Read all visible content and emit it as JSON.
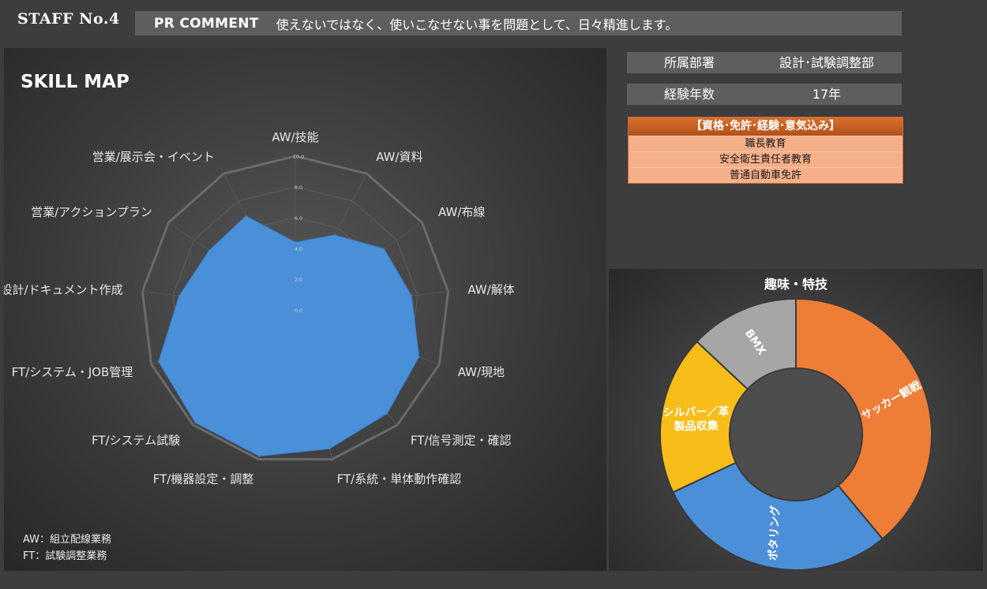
{
  "header": {
    "staff_label": "STAFF No.4",
    "pr_label": "PR COMMENT",
    "pr_text": "使えないではなく、使いこなせない事を問題として、日々精進します。"
  },
  "info": {
    "department_label": "所属部署",
    "department_value": "設計･試験調整部",
    "experience_label": "経験年数",
    "experience_value": "17年"
  },
  "qualifications": {
    "title": "【資格･免許･経験･意気込み】",
    "items": [
      "職長教育",
      "安全衛生責任者教育",
      "普通自動車免許"
    ]
  },
  "notes": {
    "aw": "AW：組立配線業務",
    "ft": "FT：試験調整業務"
  },
  "colors": {
    "radar_fill": "#4a90d9",
    "soccer": "#ee7d36",
    "potter": "#4b8fd8",
    "silver": "#f9bd1a",
    "bmx": "#a6a6a6"
  },
  "chart_data": [
    {
      "type": "radar",
      "title": "SKILL MAP",
      "categories": [
        "AW/技能",
        "AW/資料",
        "AW/布線",
        "AW/解体",
        "AW/現地",
        "FT/信号測定・確認",
        "FT/系統・単体動作確認",
        "FT/機器設定・調整",
        "FT/システム試験",
        "FT/システム・JOB管理",
        "設計/ドキュメント作成",
        "営業/アクションプラン",
        "営業/展示会・イベント"
      ],
      "values": [
        4.4,
        5.5,
        7.0,
        7.6,
        8.6,
        9.0,
        9.3,
        9.8,
        9.8,
        9.5,
        7.6,
        6.8,
        6.9
      ],
      "rlim": [
        0,
        10
      ],
      "tick_labels": [
        "0.0",
        "2.0",
        "4.0",
        "6.0",
        "8.0",
        "10.0"
      ]
    },
    {
      "type": "pie",
      "title": "趣味・特技",
      "labels": [
        "サッカー観戦",
        "ポタリング",
        "シルバー／革\n製品収集",
        "BMX"
      ],
      "values": [
        39,
        29,
        19,
        13
      ]
    }
  ]
}
